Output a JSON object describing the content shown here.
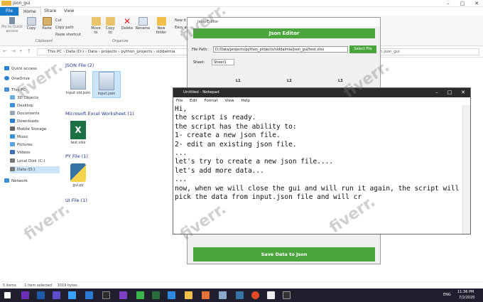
{
  "explorer": {
    "window_title": "json_gui",
    "tabs": [
      "File",
      "Home",
      "Share",
      "View"
    ],
    "ribbon": {
      "pin": "Pin to Quick access",
      "copy": "Copy",
      "paste": "Paste",
      "cut": "Cut",
      "copy_path": "Copy path",
      "paste_shortcut": "Paste shortcut",
      "move_to": "Move to",
      "copy_to": "Copy to",
      "delete": "Delete",
      "rename": "Rename",
      "new_folder": "New folder",
      "new_item": "New it",
      "easy_access": "Easy a",
      "group_clipboard": "Clipboard",
      "group_organize": "Organize"
    },
    "address_parts": [
      "This PC",
      "Data (D:)",
      "Data",
      "projects",
      "python_projects",
      "siddalmia"
    ],
    "search_placeholder": "h json_gui",
    "nav": [
      "Quick access",
      "OneDrive",
      "This PC",
      "3D Objects",
      "Desktop",
      "Documents",
      "Downloads",
      "Mobile Storage",
      "Music",
      "Pictures",
      "Videos",
      "Local Disk (C:)",
      "Data (D:)",
      "Network"
    ],
    "groups": [
      {
        "title": "JSON File (2)",
        "files": [
          "input old.json",
          "input.json"
        ]
      },
      {
        "title": "Microsoft Excel Worksheet (1)",
        "files": [
          "test.xlsx"
        ]
      },
      {
        "title": "PY File (1)",
        "files": [
          "gui.py"
        ]
      },
      {
        "title": "UI File (1)",
        "files": []
      }
    ],
    "status": [
      "5 items",
      "1 item selected",
      "1019 bytes"
    ]
  },
  "json_editor": {
    "window_title": "Json Editor",
    "header": "Json Editor",
    "file_path_label": "File Path:",
    "file_path": "D:/Data/projects/python_projects/siddalmia/json_gui/test.xlsx",
    "select_file": "Select File",
    "sheet_label": "Sheet:",
    "sheet_value": "Sheet1",
    "columns": [
      "L1",
      "L2",
      "L3"
    ],
    "save_button": "Save Data to Json"
  },
  "notepad": {
    "window_title": "Untitled - Notepad",
    "menu": [
      "File",
      "Edit",
      "Format",
      "View",
      "Help"
    ],
    "lines": [
      "Hi,",
      "the script is ready.",
      "the script has the ability to:",
      "1- create a new json file.",
      "2- edit an existing json file.",
      "...",
      "let's try to create a new json file....",
      "let's add more data...",
      "...",
      "now, when we will close the gui and will run it again, the script will",
      "pick the data from input.json file and will cr"
    ]
  },
  "taskbar": {
    "lang": "ENG",
    "time": "11:36 PM",
    "date": "7/2/2020"
  },
  "watermark": "fiverr."
}
